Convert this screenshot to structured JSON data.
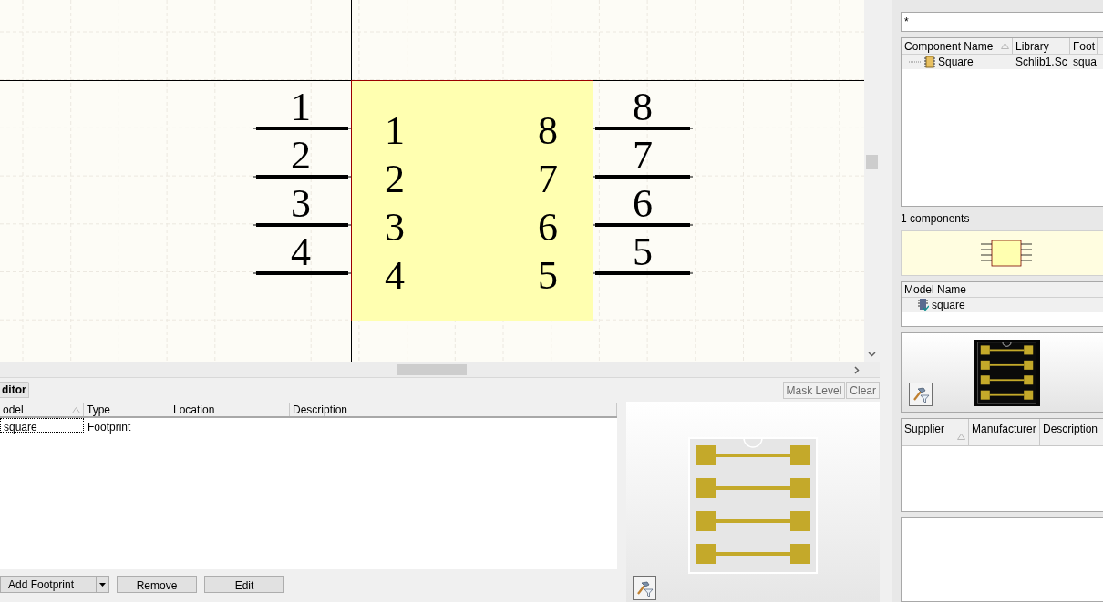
{
  "canvas": {
    "left_pins": [
      {
        "designator": "1",
        "name": "1"
      },
      {
        "designator": "2",
        "name": "2"
      },
      {
        "designator": "3",
        "name": "3"
      },
      {
        "designator": "4",
        "name": "4"
      }
    ],
    "right_pins": [
      {
        "designator": "8",
        "name": "8"
      },
      {
        "designator": "7",
        "name": "7"
      },
      {
        "designator": "6",
        "name": "6"
      },
      {
        "designator": "5",
        "name": "5"
      }
    ]
  },
  "model_editor": {
    "tab": {
      "label": "ditor",
      "selected": true
    },
    "columns": [
      "odel",
      "Type",
      "Location",
      "Description"
    ],
    "rows": [
      {
        "cells": [
          "square",
          "Footprint"
        ],
        "selected": true
      }
    ],
    "mask_buttons": [
      "Mask Level",
      "Clear"
    ],
    "buttons": [
      {
        "label": "Add Footprint",
        "kind": "split"
      },
      {
        "label": "Remove",
        "kind": "plain"
      },
      {
        "label": "Edit",
        "kind": "plain"
      }
    ]
  },
  "library_panel": {
    "search": {
      "value": "*"
    },
    "component_columns": [
      "Component Name",
      "Library",
      "Foot"
    ],
    "components": [
      {
        "cells": [
          "Square",
          "Schlib1.Sc",
          "squa"
        ],
        "selected": true
      }
    ],
    "count": "1 components",
    "model_columns": [
      "Model Name"
    ],
    "models": [
      {
        "name": "square",
        "selected": true
      }
    ],
    "supplier_columns": [
      "Supplier",
      "Manufacturer",
      "Description"
    ]
  }
}
